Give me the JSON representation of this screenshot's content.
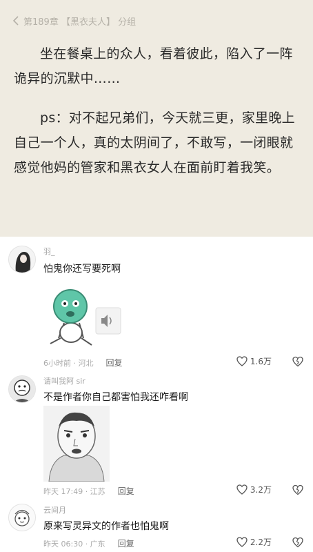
{
  "reader": {
    "chapter_title": "第189章 【黑衣夫人】 分组",
    "paragraph1": "坐在餐桌上的众人，看着彼此，陷入了一阵诡异的沉默中……",
    "paragraph2": "ps：对不起兄弟们，今天就三更，家里晚上自己一个人，真的太阴间了，不敢写，一闭眼就感觉他妈的管家和黑衣女人在面前盯着我笑。"
  },
  "comments": [
    {
      "username": "羽_",
      "text": "怕鬼你还写要死啊",
      "time": "6小时前 · 河北",
      "reply": "回复",
      "likes": "1.6万"
    },
    {
      "username": "请叫我阿 sir",
      "text": "不是作者你自己都害怕我还咋看啊",
      "time": "昨天 17:49 · 江苏",
      "reply": "回复",
      "likes": "3.2万"
    },
    {
      "username": "云间月",
      "text": "原来写灵异文的作者也怕鬼啊",
      "time": "昨天 06:30 · 广东",
      "reply": "回复",
      "likes": "2.2万"
    }
  ],
  "icons": {
    "back": "chevron-left-icon",
    "like": "heart-outline-icon",
    "dislike": "broken-heart-icon",
    "audio": "speaker-icon"
  },
  "colors": {
    "reader_bg": "#efebe1",
    "reader_text": "#2a2a2a",
    "meta_text": "#aaaaaa",
    "sticker_green": "#5fc6a8"
  }
}
